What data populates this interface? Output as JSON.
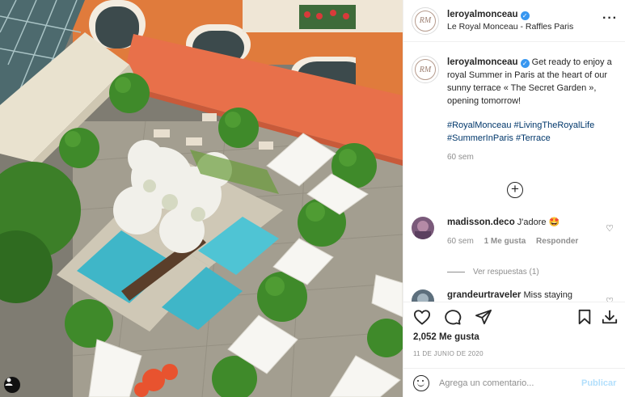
{
  "post": {
    "username": "leroyalmonceau",
    "location": "Le Royal Monceau - Raffles Paris",
    "avatar_initials": "RM",
    "more_icon": "more-options-icon"
  },
  "caption": {
    "username": "leroyalmonceau",
    "text": "Get ready to enjoy a royal Summer in Paris at the heart of our sunny terrace « The Secret Garden », opening tomorrow!",
    "hashtags": "#RoyalMonceau #LivingTheRoyalLife #SummerInParis #Terrace",
    "time": "60 sem"
  },
  "comments": [
    {
      "username": "madisson.deco",
      "text": "J'adore 🤩",
      "time": "60 sem",
      "likes": "1 Me gusta",
      "reply": "Responder",
      "view_replies": "Ver respuestas (1)"
    },
    {
      "username": "grandeurtraveler",
      "text": "Miss staying"
    }
  ],
  "actions": {
    "likes": "2,052 Me gusta",
    "date": "11 DE JUNIO DE 2020"
  },
  "composer": {
    "placeholder": "Agrega un comentario...",
    "publish": "Publicar"
  },
  "colors": {
    "verified": "#3897f0",
    "awning": "#e8704a",
    "pool": "#3fb6c8",
    "hashtag": "#00376b",
    "publish_disabled": "#b2dffc"
  }
}
